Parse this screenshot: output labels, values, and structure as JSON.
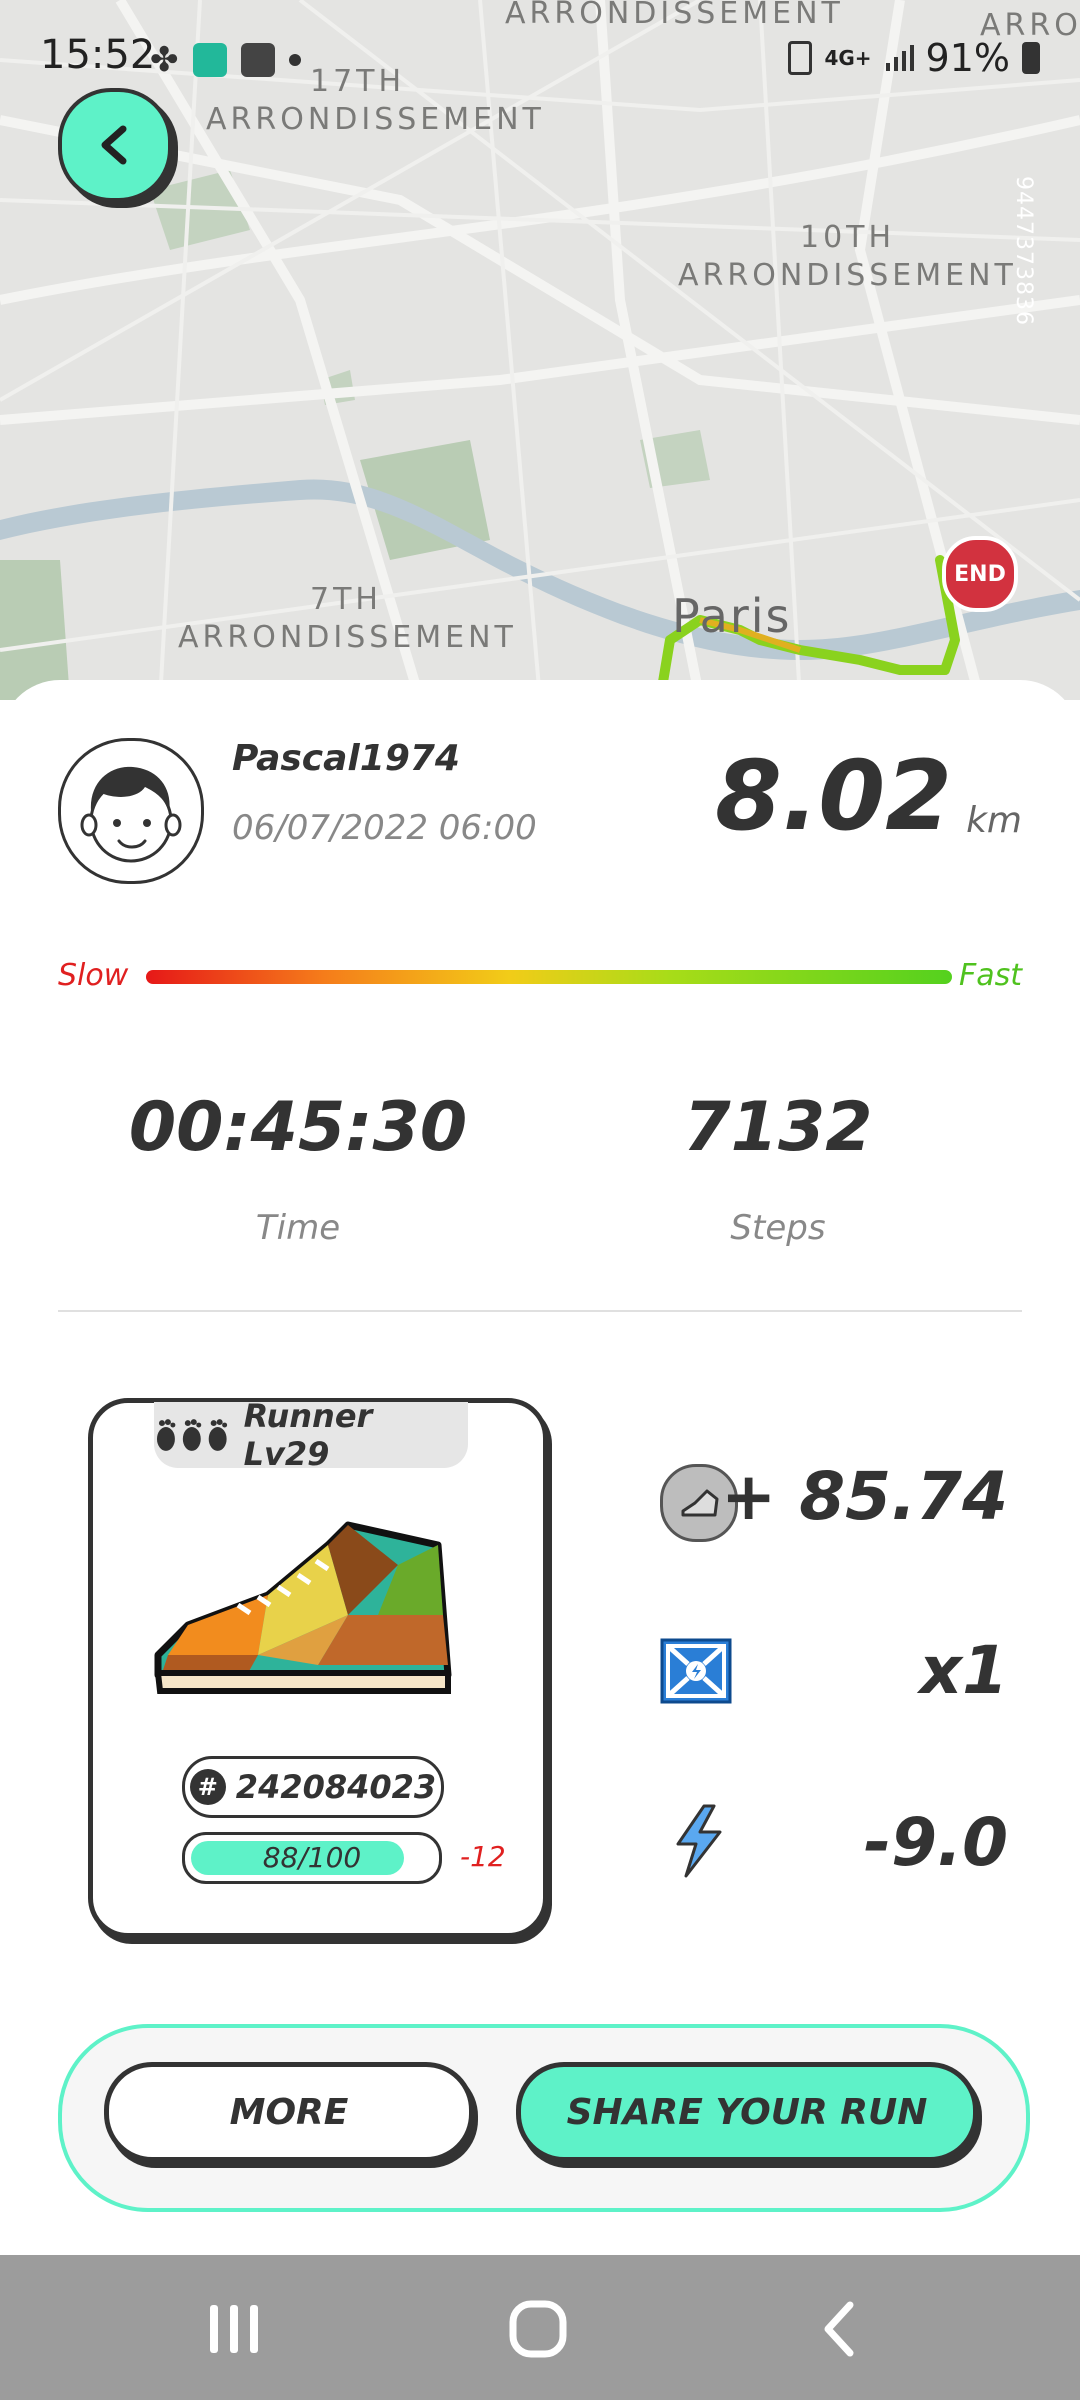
{
  "status_bar": {
    "time": "15:52",
    "battery_percent": "91%",
    "network": "4G+",
    "icons": [
      "clover-icon",
      "kucoin-icon",
      "sd-icon",
      "dot-icon",
      "battery-saver-icon",
      "signal-icon",
      "battery-icon"
    ]
  },
  "map": {
    "labels": {
      "arr17_line1": "17TH",
      "arr17_line2": "ARRONDISSEMENT",
      "arr10_line1": "10TH",
      "arr10_line2": "ARRONDISSEMENT",
      "arr7_line1": "7TH",
      "arr7_line2": "ARRONDISSEMENT",
      "top_center": "ARRONDISSEMENT",
      "top_right": "ARRO",
      "city": "Paris"
    },
    "map_id": "9447373836",
    "end_marker": "END"
  },
  "run": {
    "username": "Pascal1974",
    "datetime": "06/07/2022 06:00",
    "distance": "8.02",
    "distance_unit": "km",
    "speed_scale": {
      "slow_label": "Slow",
      "fast_label": "Fast"
    },
    "time_value": "00:45:30",
    "time_label": "Time",
    "steps_value": "7132",
    "steps_label": "Steps"
  },
  "sneaker": {
    "level_label": "Runner Lv29",
    "id_hash": "#",
    "id": "242084023",
    "durability_text": "88/100",
    "durability_fraction": 0.88,
    "durability_delta": "-12"
  },
  "rewards": {
    "gst": "+ 85.74",
    "mystery_box": "x1",
    "energy": "-9.0"
  },
  "buttons": {
    "more": "MORE",
    "share": "SHARE YOUR RUN"
  },
  "colors": {
    "accent": "#5ef2c8",
    "dark": "#333333",
    "slow": "#e02020",
    "fast": "#4fc21e",
    "route": "#8ad21e"
  }
}
